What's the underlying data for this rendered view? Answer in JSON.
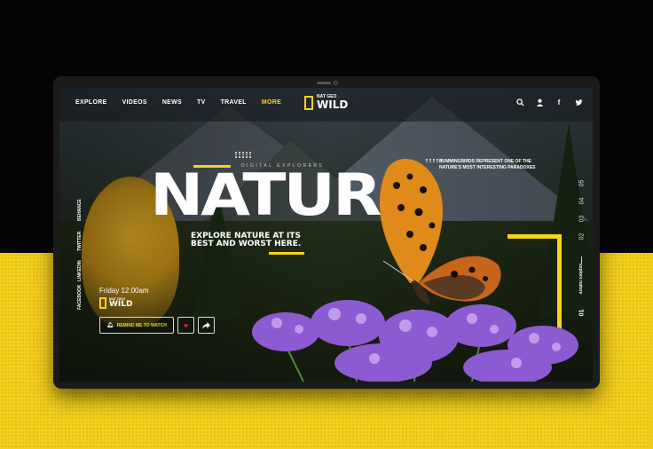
{
  "nav": {
    "links": [
      "EXPLORE",
      "VIDEOS",
      "NEWS",
      "TV",
      "TRAVEL",
      "MORE"
    ],
    "active_index": 5,
    "icons": [
      "search-icon",
      "user-icon",
      "facebook-icon",
      "twitter-icon"
    ]
  },
  "logo": {
    "top": "NAT GEO",
    "main": "WILD"
  },
  "hero": {
    "eyebrow": "DIGITAL EXPLORERS",
    "title": "NATURE",
    "side_note": "HUMMINGBIRDS REPRESENT ONE OF THE NATURE'S MOST INTERESTING PARADOXES",
    "tagline": "EXPLORE NATURE AT ITS BEST AND WORST HERE."
  },
  "social": [
    "BEHANCE",
    "TWITTER",
    "LINKEDIN",
    "FACEBOOK"
  ],
  "schedule": {
    "time": "Friday 12.00am"
  },
  "actions": {
    "remind_label": "REMIND ME TO WATCH"
  },
  "slider": {
    "numbers": [
      "05",
      "04",
      "03",
      "02",
      "01"
    ],
    "active": "01",
    "label": "explore nature"
  },
  "colors": {
    "accent": "#f7d21a",
    "heart": "#e0182a",
    "background_lower": "#f2cf1c"
  }
}
